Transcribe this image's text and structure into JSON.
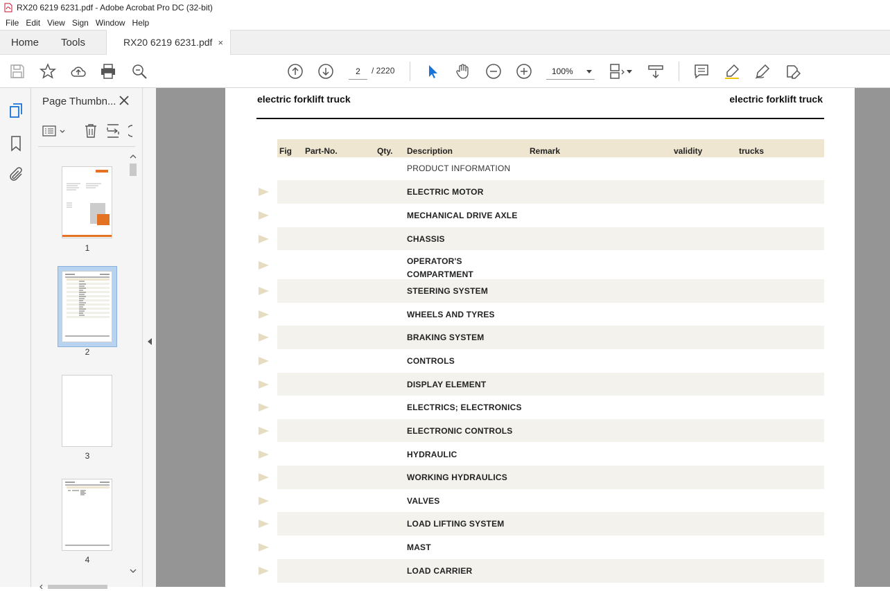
{
  "window": {
    "title": "RX20 6219 6231.pdf - Adobe Acrobat Pro DC (32-bit)"
  },
  "menu": [
    "File",
    "Edit",
    "View",
    "Sign",
    "Window",
    "Help"
  ],
  "tabs": {
    "home": "Home",
    "tools": "Tools",
    "document": "RX20 6219 6231.pdf",
    "close": "×"
  },
  "toolbar": {
    "current_page": "2",
    "page_total": "/ 2220",
    "zoom": "100%"
  },
  "thumbnails": {
    "title": "Page Thumbn...",
    "pages": [
      {
        "label": "1"
      },
      {
        "label": "2",
        "selected": true
      },
      {
        "label": "3"
      },
      {
        "label": "4"
      }
    ]
  },
  "document": {
    "header_left": "electric forklift truck",
    "header_right": "electric forklift truck",
    "columns": {
      "fig": "Fig",
      "part_no": "Part-No.",
      "qty": "Qty.",
      "description": "Description",
      "remark": "Remark",
      "validity": "validity",
      "trucks": "trucks"
    },
    "rows": [
      {
        "text": "PRODUCT INFORMATION",
        "plain": true
      },
      {
        "text": "ELECTRIC MOTOR"
      },
      {
        "text": "MECHANICAL DRIVE AXLE"
      },
      {
        "text": "CHASSIS"
      },
      {
        "text": "OPERATOR'S",
        "text2": "COMPARTMENT"
      },
      {
        "text": "STEERING SYSTEM"
      },
      {
        "text": "WHEELS AND TYRES"
      },
      {
        "text": "BRAKING SYSTEM"
      },
      {
        "text": "CONTROLS"
      },
      {
        "text": "DISPLAY ELEMENT"
      },
      {
        "text": "ELECTRICS; ELECTRONICS"
      },
      {
        "text": "ELECTRONIC CONTROLS"
      },
      {
        "text": "HYDRAULIC"
      },
      {
        "text": "WORKING HYDRAULICS"
      },
      {
        "text": "VALVES"
      },
      {
        "text": "LOAD LIFTING SYSTEM"
      },
      {
        "text": "MAST"
      },
      {
        "text": "LOAD CARRIER"
      }
    ]
  },
  "colors": {
    "row_shade": "#f3f2ec",
    "header_band": "#efe6d1",
    "canvas": "#959595",
    "selection": "#b8d3ef"
  }
}
